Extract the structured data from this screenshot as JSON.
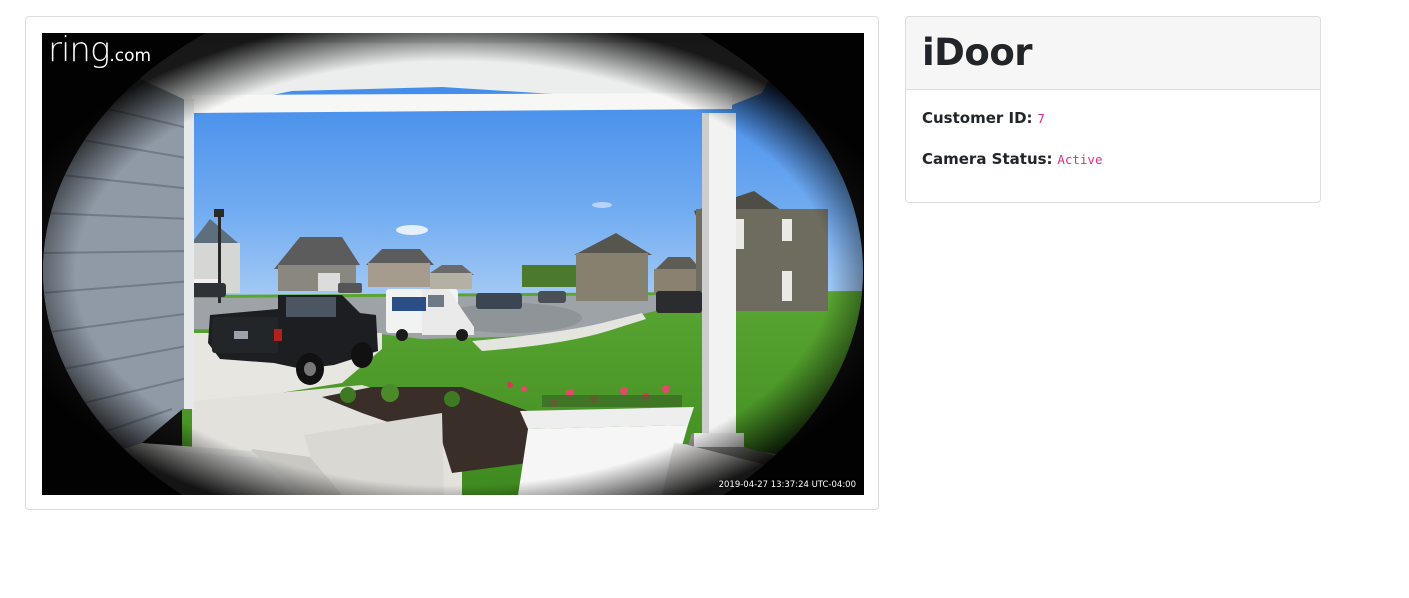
{
  "camera": {
    "watermark_main": "ring",
    "watermark_suffix": ".com",
    "timestamp": "2019-04-27 13:37:24 UTC-04:00"
  },
  "panel": {
    "title": "iDoor",
    "customer_id_label": "Customer ID:",
    "customer_id_value": "7",
    "camera_status_label": "Camera Status:",
    "camera_status_value": "Active"
  },
  "colors": {
    "code_value": "#d63384",
    "header_bg": "#f6f6f6",
    "border": "#dcdcdc"
  }
}
